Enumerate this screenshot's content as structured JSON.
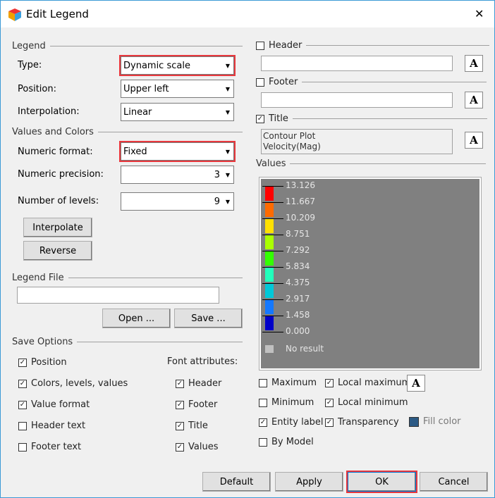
{
  "window": {
    "title": "Edit Legend",
    "close": "✕"
  },
  "legend_group": {
    "title": "Legend",
    "type_label": "Type:",
    "type_value": "Dynamic scale",
    "position_label": "Position:",
    "position_value": "Upper left",
    "interp_label": "Interpolation:",
    "interp_value": "Linear"
  },
  "values_colors": {
    "title": "Values and Colors",
    "numeric_format_label": "Numeric format:",
    "numeric_format_value": "Fixed",
    "precision_label": "Numeric precision:",
    "precision_value": "3",
    "levels_label": "Number of levels:",
    "levels_value": "9",
    "interpolate": "Interpolate",
    "reverse": "Reverse"
  },
  "legend_file": {
    "title": "Legend File",
    "value": "",
    "open": "Open ...",
    "save": "Save ..."
  },
  "save_options": {
    "title": "Save Options",
    "font_title": "Font attributes:",
    "left": [
      {
        "label": "Position",
        "checked": true
      },
      {
        "label": "Colors, levels, values",
        "checked": true
      },
      {
        "label": "Value format",
        "checked": true
      },
      {
        "label": "Header text",
        "checked": false
      },
      {
        "label": "Footer text",
        "checked": false
      }
    ],
    "right": [
      {
        "label": "Header",
        "checked": true
      },
      {
        "label": "Footer",
        "checked": true
      },
      {
        "label": "Title",
        "checked": true
      },
      {
        "label": "Values",
        "checked": true
      }
    ]
  },
  "header": {
    "label": "Header",
    "checked": false,
    "value": ""
  },
  "footer": {
    "label": "Footer",
    "checked": false,
    "value": ""
  },
  "title": {
    "label": "Title",
    "checked": true,
    "line1": "Contour Plot",
    "line2": "Velocity(Mag)"
  },
  "font_button": "A",
  "values": {
    "title": "Values",
    "levels": [
      "13.126",
      "11.667",
      "10.209",
      "8.751",
      "7.292",
      "5.834",
      "4.375",
      "2.917",
      "1.458",
      "0.000"
    ],
    "colors": [
      "#ff0000",
      "#ff6a00",
      "#ffe000",
      "#aaff00",
      "#33ff00",
      "#22ffbb",
      "#00c8d8",
      "#1478ff",
      "#0000c8"
    ],
    "no_result": "No result",
    "no_result_color": "#c0c0c0"
  },
  "options": {
    "maximum": {
      "label": "Maximum",
      "checked": false
    },
    "local_maximum": {
      "label": "Local maximum",
      "checked": true
    },
    "minimum": {
      "label": "Minimum",
      "checked": false
    },
    "local_minimum": {
      "label": "Local minimum",
      "checked": true
    },
    "entity_label": {
      "label": "Entity label",
      "checked": true
    },
    "transparency": {
      "label": "Transparency",
      "checked": true
    },
    "fill_color": {
      "label": "Fill color",
      "color": "#2c5a85"
    },
    "by_model": {
      "label": "By Model",
      "checked": false
    }
  },
  "buttons": {
    "default": "Default",
    "apply": "Apply",
    "ok": "OK",
    "cancel": "Cancel"
  }
}
